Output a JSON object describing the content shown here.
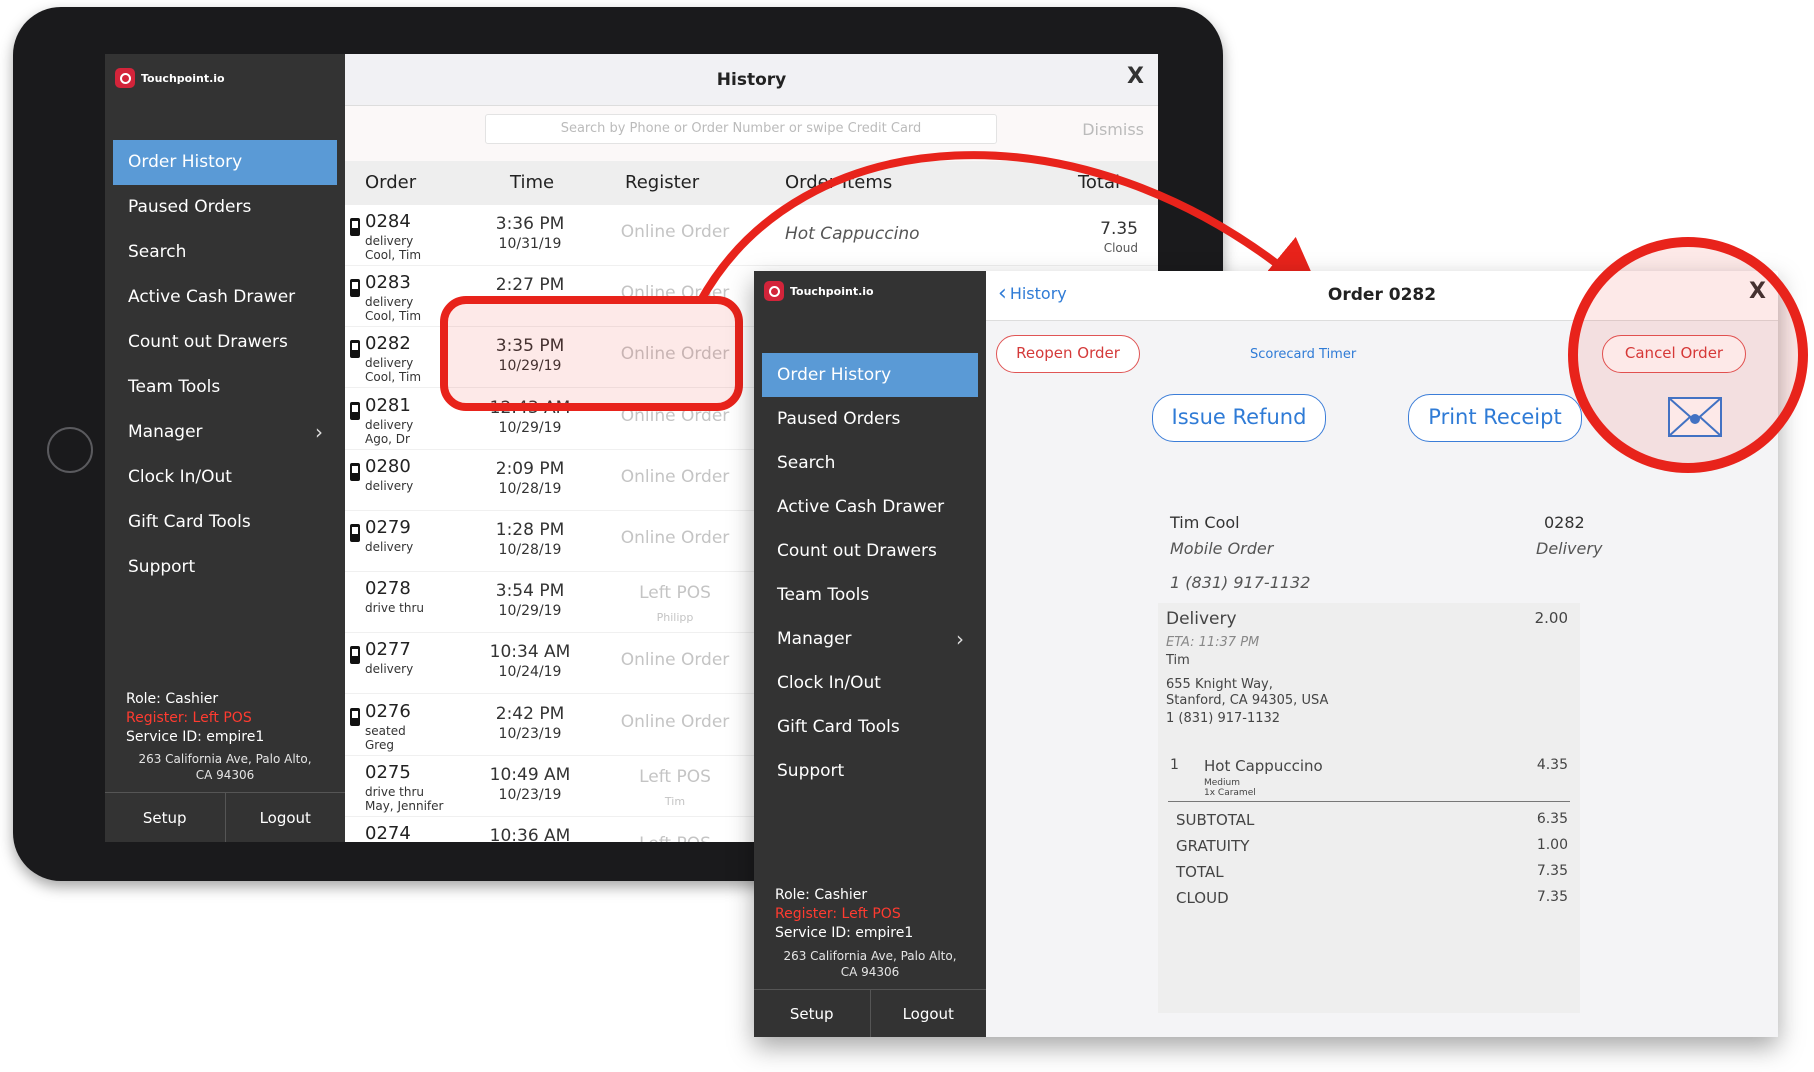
{
  "app": {
    "logo_text": "Touchpoint.io",
    "accent": "#5a9ad6",
    "brand_red": "#d3243a",
    "highlight_red": "#e8231b"
  },
  "sidebar": {
    "items": [
      {
        "label": "Order History",
        "active": true
      },
      {
        "label": "Paused Orders"
      },
      {
        "label": "Search"
      },
      {
        "label": "Active Cash Drawer"
      },
      {
        "label": "Count out Drawers"
      },
      {
        "label": "Team Tools"
      },
      {
        "label": "Manager",
        "has_submenu": true
      },
      {
        "label": "Clock In/Out"
      },
      {
        "label": "Gift Card Tools"
      },
      {
        "label": "Support"
      }
    ],
    "role": "Role: Cashier",
    "register": "Register: Left POS",
    "service_id": "Service ID: empire1",
    "address_line1": "263 California Ave, Palo Alto,",
    "address_line2": "CA 94306",
    "setup": "Setup",
    "logout": "Logout"
  },
  "history": {
    "title": "History",
    "close": "X",
    "search_placeholder": "Search by Phone or Order Number or swipe Credit Card",
    "dismiss": "Dismiss",
    "columns": {
      "order": "Order",
      "time": "Time",
      "register": "Register",
      "items": "Order Items",
      "total": "Total"
    },
    "rows": [
      {
        "num": "0284",
        "type": "delivery",
        "name": "Cool, Tim",
        "time": "3:36 PM",
        "date": "10/31/19",
        "register": "Online Order",
        "register2": "",
        "item": "Hot Cappuccino",
        "total": "7.35",
        "total2": "Cloud",
        "mobile": true
      },
      {
        "num": "0283",
        "type": "delivery",
        "name": "Cool, Tim",
        "time": "2:27 PM",
        "date": "",
        "register": "Online Order",
        "register2": "",
        "item": "",
        "total": "",
        "total2": "",
        "mobile": true
      },
      {
        "num": "0282",
        "type": "delivery",
        "name": "Cool, Tim",
        "time": "3:35 PM",
        "date": "10/29/19",
        "register": "Online Order",
        "register2": "",
        "item": "",
        "total": "",
        "total2": "",
        "mobile": true
      },
      {
        "num": "0281",
        "type": "delivery",
        "name": "Ago, Dr",
        "time": "12:43 AM",
        "date": "10/29/19",
        "register": "Online Order",
        "register2": "",
        "item": "",
        "total": "",
        "total2": "",
        "mobile": true
      },
      {
        "num": "0280",
        "type": "delivery",
        "name": "",
        "time": "2:09 PM",
        "date": "10/28/19",
        "register": "Online Order",
        "register2": "",
        "item": "",
        "total": "",
        "total2": "",
        "mobile": true
      },
      {
        "num": "0279",
        "type": "delivery",
        "name": "",
        "time": "1:28 PM",
        "date": "10/28/19",
        "register": "Online Order",
        "register2": "",
        "item": "",
        "total": "",
        "total2": "",
        "mobile": true
      },
      {
        "num": "0278",
        "type": "drive thru",
        "name": "",
        "time": "3:54 PM",
        "date": "10/29/19",
        "register": "Left POS",
        "register2": "Philipp",
        "item": "",
        "total": "",
        "total2": "",
        "mobile": false
      },
      {
        "num": "0277",
        "type": "delivery",
        "name": "",
        "time": "10:34 AM",
        "date": "10/24/19",
        "register": "Online Order",
        "register2": "",
        "item": "",
        "total": "",
        "total2": "",
        "mobile": true
      },
      {
        "num": "0276",
        "type": "seated",
        "name": "Greg",
        "time": "2:42 PM",
        "date": "10/23/19",
        "register": "Online Order",
        "register2": "",
        "item": "",
        "total": "",
        "total2": "",
        "mobile": true
      },
      {
        "num": "0275",
        "type": "drive thru",
        "name": "May, Jennifer",
        "time": "10:49 AM",
        "date": "10/23/19",
        "register": "Left POS",
        "register2": "Tim",
        "item": "",
        "total": "",
        "total2": "",
        "mobile": false
      },
      {
        "num": "0274",
        "type": "drive thru",
        "name": "",
        "time": "10:36 AM",
        "date": "",
        "register": "Left POS",
        "register2": "",
        "item": "",
        "total": "",
        "total2": "",
        "mobile": false
      }
    ]
  },
  "order": {
    "back": "History",
    "title": "Order 0282",
    "close": "X",
    "reopen": "Reopen Order",
    "scorecard": "Scorecard Timer",
    "cancel": "Cancel Order",
    "refund": "Issue Refund",
    "print": "Print Receipt",
    "email_icon": "envelope-icon",
    "receipt": {
      "customer": "Tim Cool",
      "order_num": "0282",
      "channel": "Mobile Order",
      "fulfillment": "Delivery",
      "phone": "1 (831) 917-1132",
      "delivery_label": "Delivery",
      "delivery_fee": "2.00",
      "eta": "ETA: 11:37 PM",
      "recipient": "Tim",
      "addr1": "655 Knight Way,",
      "addr2": "Stanford, CA 94305, USA",
      "addr_phone": "1 (831) 917-1132",
      "item_qty": "1",
      "item_name": "Hot Cappuccino",
      "item_price": "4.35",
      "mod1": "Medium",
      "mod2": "1x Caramel",
      "subtotal_label": "SUBTOTAL",
      "subtotal": "6.35",
      "gratuity_label": "GRATUITY",
      "gratuity": "1.00",
      "total_label": "TOTAL",
      "total": "7.35",
      "cloud_label": "CLOUD",
      "cloud": "7.35"
    }
  }
}
